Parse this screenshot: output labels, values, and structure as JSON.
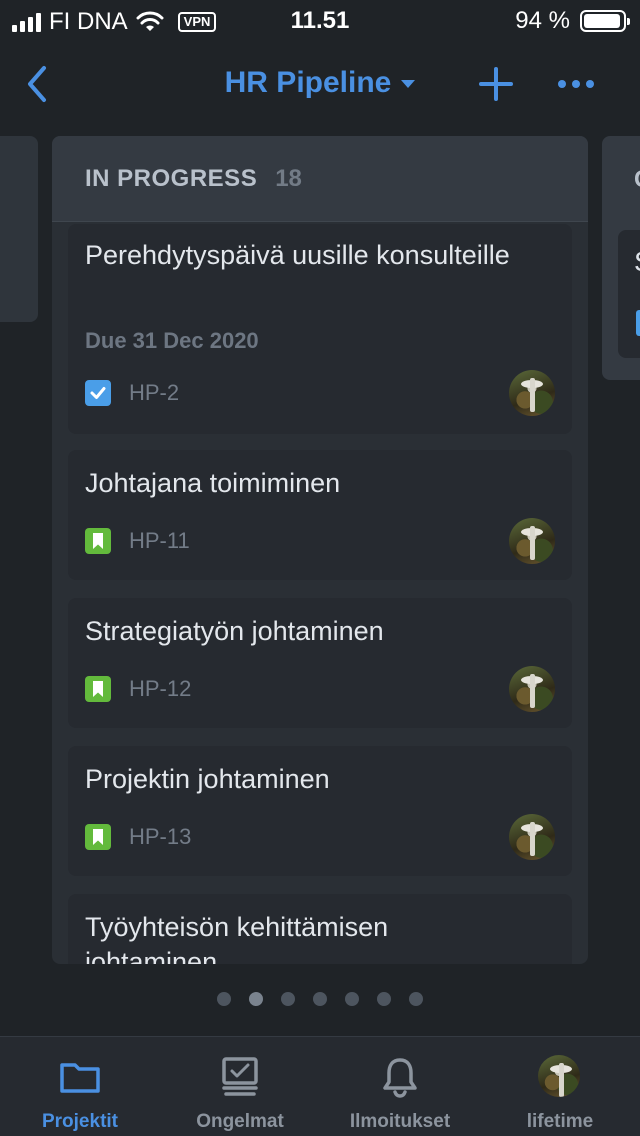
{
  "status_bar": {
    "carrier": "FI DNA",
    "vpn": "VPN",
    "time": "11.51",
    "battery": "94 %",
    "battery_level": 0.94
  },
  "nav": {
    "title": "HR Pipeline"
  },
  "column": {
    "name": "IN PROGRESS",
    "count": "18",
    "next_header": "C",
    "next_card_title": "S"
  },
  "cards": [
    {
      "title": "Perehdytyspäivä uusille konsulteille",
      "due": "Due 31 Dec 2020",
      "type": "task",
      "key": "HP-2"
    },
    {
      "title": "Johtajana toimiminen",
      "type": "story",
      "key": "HP-11"
    },
    {
      "title": "Strategiatyön johtaminen",
      "type": "story",
      "key": "HP-12"
    },
    {
      "title": "Projektin johtaminen",
      "type": "story",
      "key": "HP-13"
    },
    {
      "title": "Työyhteisön kehittämisen johtaminen",
      "type": "story",
      "key": ""
    }
  ],
  "pagination": {
    "pages": 7,
    "active": 1
  },
  "tabs": [
    {
      "label": "Projektit",
      "icon": "folder-icon",
      "active": true
    },
    {
      "label": "Ongelmat",
      "icon": "monitor-check-icon",
      "active": false
    },
    {
      "label": "Ilmoitukset",
      "icon": "bell-icon",
      "active": false
    },
    {
      "label": "lifetime",
      "icon": "avatar",
      "active": false
    }
  ],
  "colors": {
    "accent": "#4a90e2",
    "task": "#4a9ee8",
    "story": "#63ba3c",
    "background": "#1f2327"
  }
}
